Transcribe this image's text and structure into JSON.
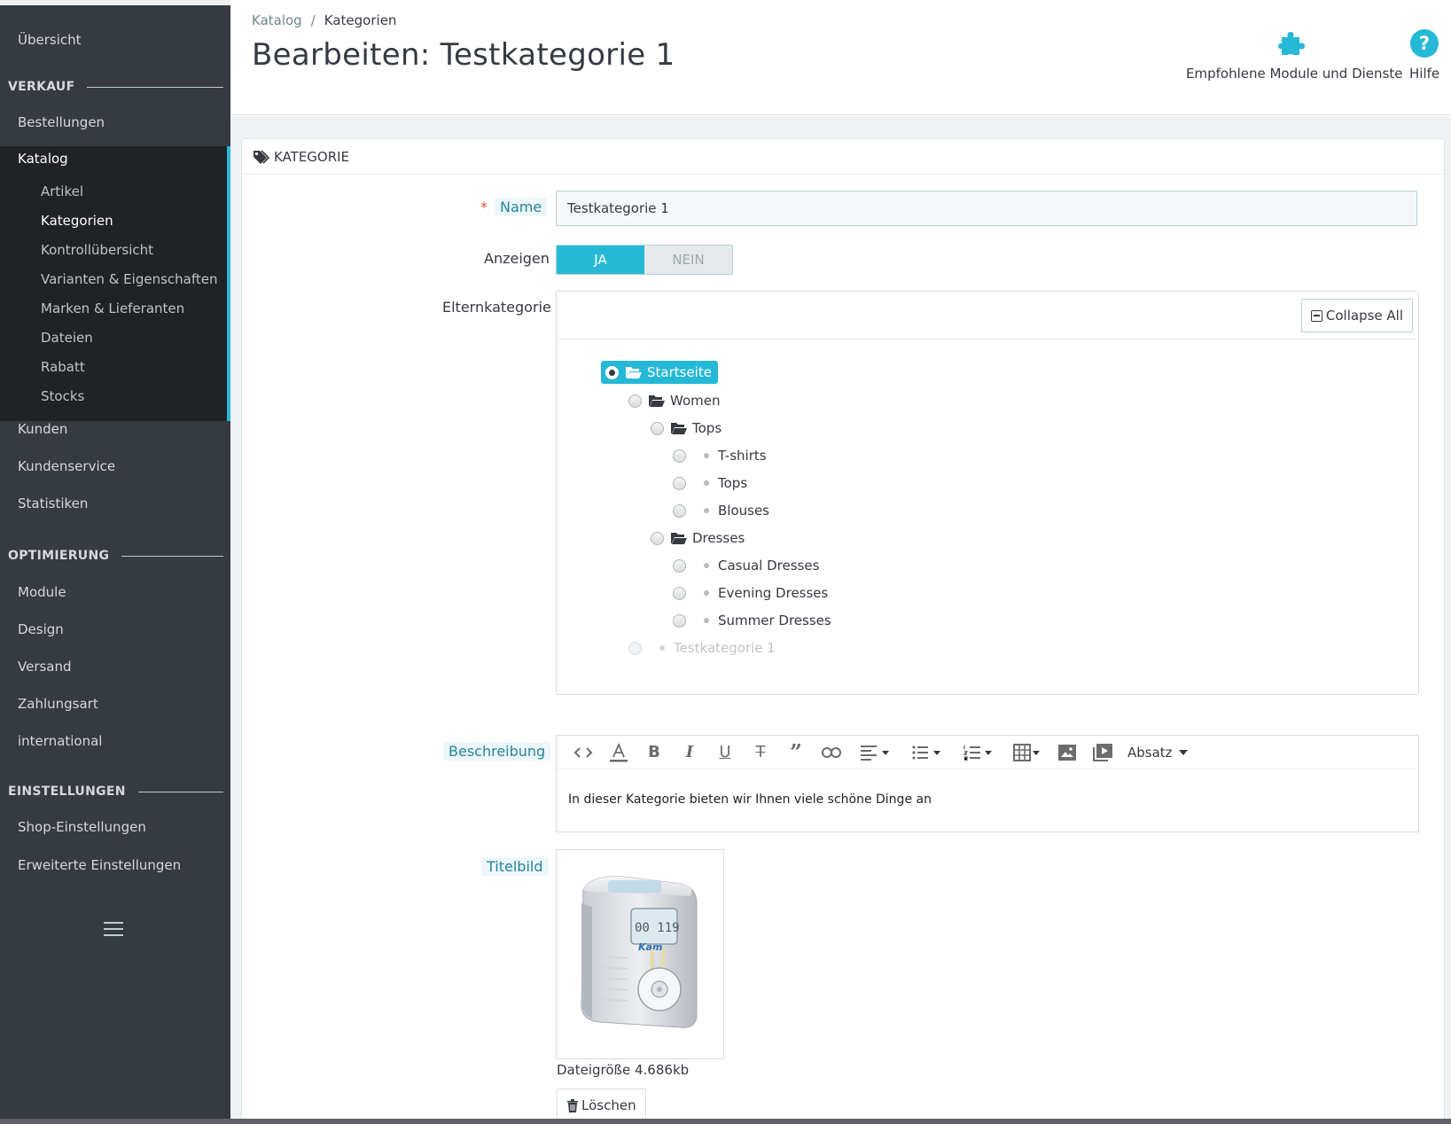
{
  "sidebar": {
    "overview": "Übersicht",
    "section_sales": "VERKAUF",
    "orders": "Bestellungen",
    "catalog": "Katalog",
    "catalog_sub": [
      "Artikel",
      "Kategorien",
      "Kontrollübersicht",
      "Varianten & Eigenschaften",
      "Marken & Lieferanten",
      "Dateien",
      "Rabatt",
      "Stocks"
    ],
    "customers": "Kunden",
    "customer_service": "Kundenservice",
    "statistics": "Statistiken",
    "section_optimize": "OPTIMIERUNG",
    "modules": "Module",
    "design": "Design",
    "shipping": "Versand",
    "payment": "Zahlungsart",
    "international": "international",
    "section_settings": "EINSTELLUNGEN",
    "shop_settings": "Shop-Einstellungen",
    "advanced_settings": "Erweiterte Einstellungen"
  },
  "header": {
    "breadcrumb_parent": "Katalog",
    "breadcrumb_sep": "/",
    "breadcrumb_current": "Kategorien",
    "title": "Bearbeiten: Testkategorie 1",
    "modules_label": "Empfohlene Module und Dienste",
    "help_label": "Hilfe",
    "accent": "#25b9d7"
  },
  "panel": {
    "heading": "KATEGORIE",
    "name_required": "*",
    "name_label": "Name",
    "name_value": "Testkategorie 1",
    "show_label": "Anzeigen",
    "show_yes": "JA",
    "show_no": "NEIN",
    "parent_label": "Elternkategorie",
    "collapse_all": "Collapse All",
    "tree": {
      "root": "Startseite",
      "women": "Women",
      "tops": "Tops",
      "tshirts": "T-shirts",
      "tops_leaf": "Tops",
      "blouses": "Blouses",
      "dresses": "Dresses",
      "casual": "Casual Dresses",
      "evening": "Evening Dresses",
      "summer": "Summer Dresses",
      "current": "Testkategorie 1"
    },
    "description_label": "Beschreibung",
    "paragraph_select": "Absatz",
    "description_text": "In dieser Kategorie bieten wir Ihnen viele schöne Dinge an",
    "cover_label": "Titelbild",
    "filesize": "Dateigröße 4.686kb",
    "delete_label": "Löschen"
  }
}
